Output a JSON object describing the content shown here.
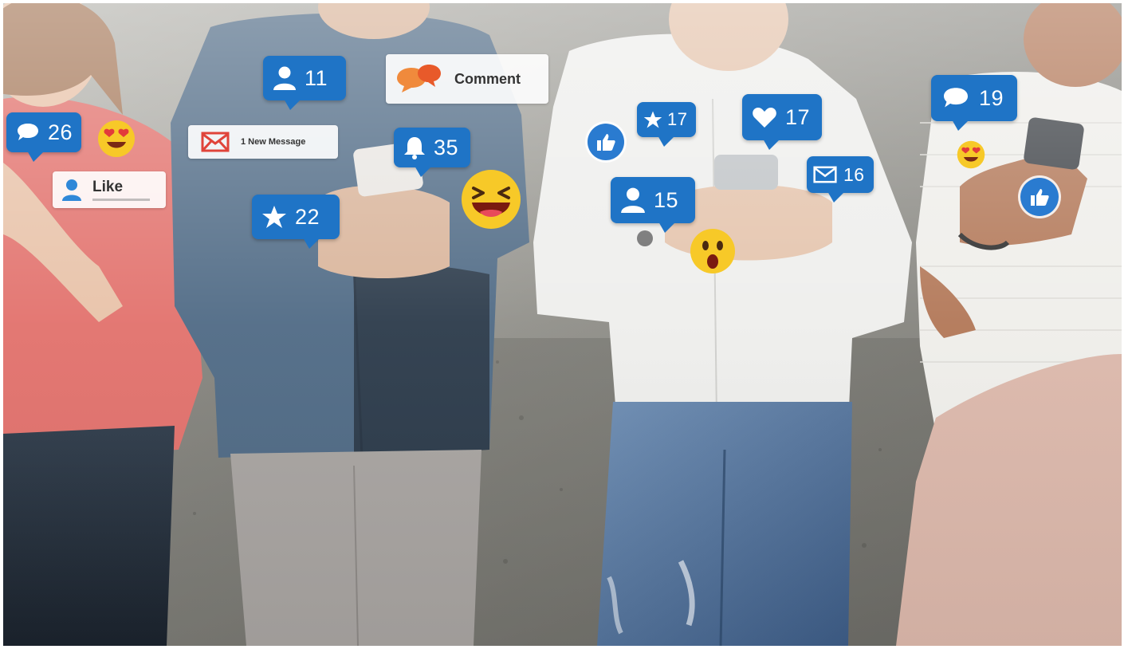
{
  "notifications": {
    "followers_left": "11",
    "comment_label": "Comment",
    "messages_left": "26",
    "new_message_label": "1 New Message",
    "alerts": "35",
    "stars_left": "22",
    "like_label": "Like",
    "stars_middle": "17",
    "hearts": "17",
    "followers_middle": "15",
    "mail_middle": "16",
    "messages_right": "19"
  },
  "icons": [
    "person-icon",
    "comment-bubbles-icon",
    "chat-bubble-icon",
    "mail-icon",
    "bell-icon",
    "star-icon",
    "person-icon",
    "heart-icon",
    "thumbs-up-icon",
    "laughing-emoji",
    "heart-eyes-emoji",
    "surprised-emoji"
  ],
  "colors": {
    "bubble_blue": "#1f74c6",
    "card_white": "#ffffff",
    "emoji_yellow": "#f7c928"
  }
}
